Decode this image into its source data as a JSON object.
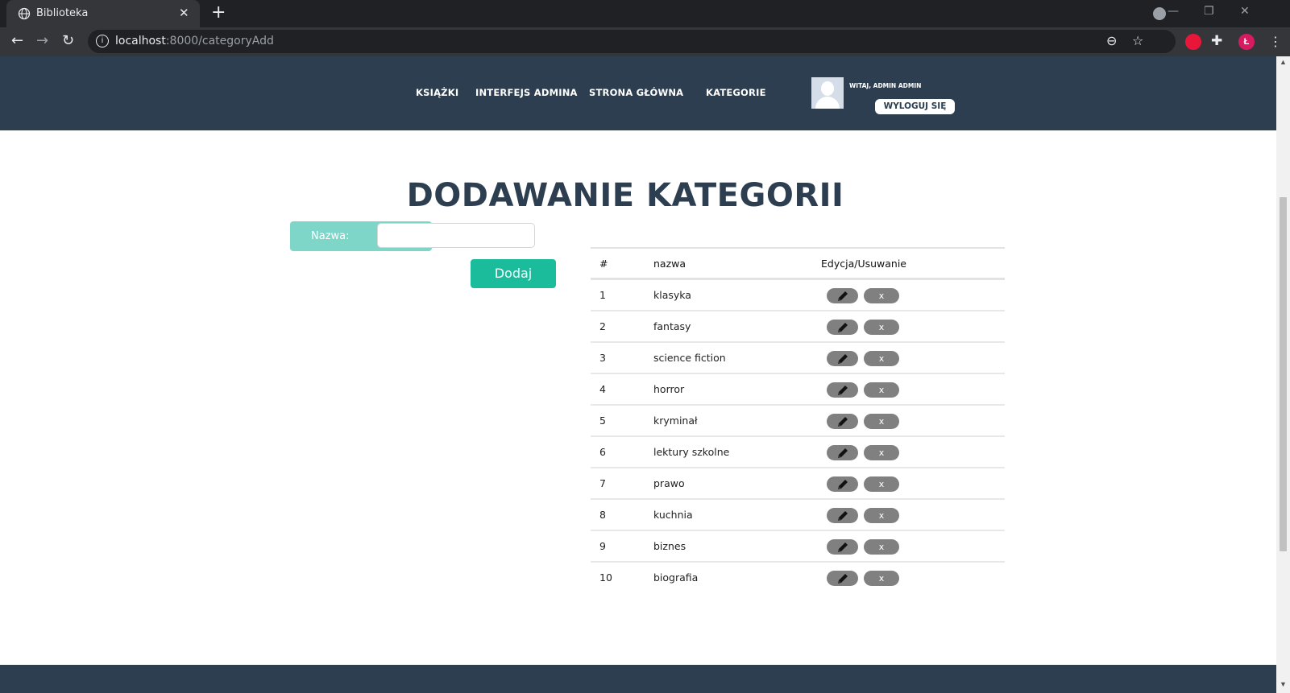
{
  "browser": {
    "tab_title": "Biblioteka",
    "tab_close": "✕",
    "new_tab": "+",
    "url_host": "localhost",
    "url_rest": ":8000/categoryAdd",
    "profile_initial": "Ł",
    "window_controls": {
      "minimize": "—",
      "restore": "❐",
      "close": "✕"
    },
    "accent_colors": {
      "chrome_dark": "#202124",
      "chrome_toolbar": "#35363a",
      "profile": "#d81b60"
    }
  },
  "header": {
    "nav": [
      "KSIĄŻKI",
      "INTERFEJS ADMINA",
      "STRONA GŁÓWNA",
      "KATEGORIE"
    ],
    "greeting": "WITAJ, ADMIN ADMIN",
    "logout_label": "WYLOGUJ SIĘ",
    "colors": {
      "header_bg": "#2c3e50"
    }
  },
  "page": {
    "title": "DODAWANIE KATEGORII"
  },
  "form": {
    "name_label": "Nazwa:",
    "name_value": "",
    "add_label": "Dodaj",
    "colors": {
      "label_bg": "#7dd6c7",
      "button": "#1abc9c"
    }
  },
  "table": {
    "headers": [
      "#",
      "nazwa",
      "Edycja/Usuwanie"
    ],
    "delete_label": "x",
    "rows": [
      {
        "id": "1",
        "name": "klasyka"
      },
      {
        "id": "2",
        "name": "fantasy"
      },
      {
        "id": "3",
        "name": "science fiction"
      },
      {
        "id": "4",
        "name": "horror"
      },
      {
        "id": "5",
        "name": "kryminał"
      },
      {
        "id": "6",
        "name": "lektury szkolne"
      },
      {
        "id": "7",
        "name": "prawo"
      },
      {
        "id": "8",
        "name": "kuchnia"
      },
      {
        "id": "9",
        "name": "biznes"
      },
      {
        "id": "10",
        "name": "biografia"
      }
    ]
  }
}
